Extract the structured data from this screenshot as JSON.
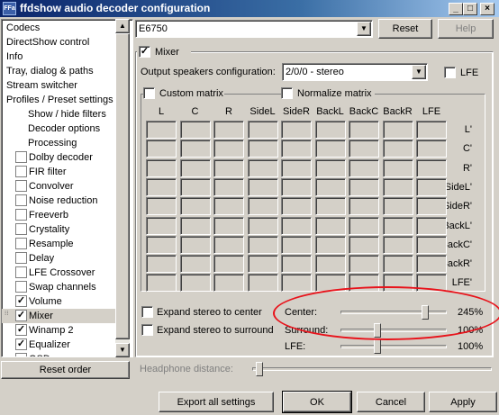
{
  "window": {
    "title": "ffdshow audio decoder configuration",
    "icon_text": "FFa",
    "minimize_icon": "minimize-icon",
    "maximize_icon": "maximize-icon",
    "close_icon": "close-icon"
  },
  "sidebar": {
    "items": [
      {
        "label": "Codecs",
        "indent": 0,
        "checkbox": null
      },
      {
        "label": "DirectShow control",
        "indent": 0,
        "checkbox": null
      },
      {
        "label": "Info",
        "indent": 0,
        "checkbox": null
      },
      {
        "label": "Tray, dialog & paths",
        "indent": 0,
        "checkbox": null
      },
      {
        "label": "Stream switcher",
        "indent": 0,
        "checkbox": null
      },
      {
        "label": "Profiles / Preset settings",
        "indent": 0,
        "checkbox": null
      },
      {
        "label": "Show / hide filters",
        "indent": 2,
        "checkbox": null
      },
      {
        "label": "Decoder options",
        "indent": 2,
        "checkbox": null
      },
      {
        "label": "Processing",
        "indent": 2,
        "checkbox": null
      },
      {
        "label": "Dolby decoder",
        "indent": 1,
        "checkbox": false
      },
      {
        "label": "FIR filter",
        "indent": 1,
        "checkbox": false
      },
      {
        "label": "Convolver",
        "indent": 1,
        "checkbox": false
      },
      {
        "label": "Noise reduction",
        "indent": 1,
        "checkbox": false
      },
      {
        "label": "Freeverb",
        "indent": 1,
        "checkbox": false
      },
      {
        "label": "Crystality",
        "indent": 1,
        "checkbox": false
      },
      {
        "label": "Resample",
        "indent": 1,
        "checkbox": false
      },
      {
        "label": "Delay",
        "indent": 1,
        "checkbox": false
      },
      {
        "label": "LFE Crossover",
        "indent": 1,
        "checkbox": false
      },
      {
        "label": "Swap channels",
        "indent": 1,
        "checkbox": false
      },
      {
        "label": "Volume",
        "indent": 1,
        "checkbox": true
      },
      {
        "label": "Mixer",
        "indent": 1,
        "checkbox": true,
        "selected": true
      },
      {
        "label": "Winamp 2",
        "indent": 1,
        "checkbox": true
      },
      {
        "label": "Equalizer",
        "indent": 1,
        "checkbox": true
      },
      {
        "label": "OSD",
        "indent": 1,
        "checkbox": false
      }
    ],
    "reset_order_label": "Reset order"
  },
  "preset": {
    "selected": "E6750",
    "reset_label": "Reset",
    "help_label": "Help"
  },
  "mixer": {
    "enabled_label": "Mixer",
    "enabled": true,
    "output_config_label": "Output speakers configuration:",
    "output_config_value": "2/0/0 - stereo",
    "lfe_label": "LFE",
    "lfe_checked": false,
    "custom_matrix_label": "Custom matrix",
    "custom_matrix_checked": false,
    "normalize_matrix_label": "Normalize matrix",
    "normalize_matrix_checked": false,
    "matrix_columns": [
      "L",
      "C",
      "R",
      "SideL",
      "SideR",
      "BackL",
      "BackC",
      "BackR",
      "LFE"
    ],
    "matrix_rows": [
      "L'",
      "C'",
      "R'",
      "SideL'",
      "SideR'",
      "BackL'",
      "BackC'",
      "BackR'",
      "LFE'"
    ],
    "expand_center_label": "Expand stereo to center",
    "expand_center_checked": false,
    "expand_surround_label": "Expand stereo to surround",
    "expand_surround_checked": false,
    "center": {
      "label": "Center:",
      "value_text": "245%",
      "value": 245
    },
    "surround": {
      "label": "Surround:",
      "value_text": "100%",
      "value": 100
    },
    "lfe_level": {
      "label": "LFE:",
      "value_text": "100%",
      "value": 100
    },
    "headphone_distance_label": "Headphone distance:"
  },
  "footer": {
    "export_label": "Export all settings",
    "ok_label": "OK",
    "cancel_label": "Cancel",
    "apply_label": "Apply"
  },
  "annotation_color": "#e8131b"
}
